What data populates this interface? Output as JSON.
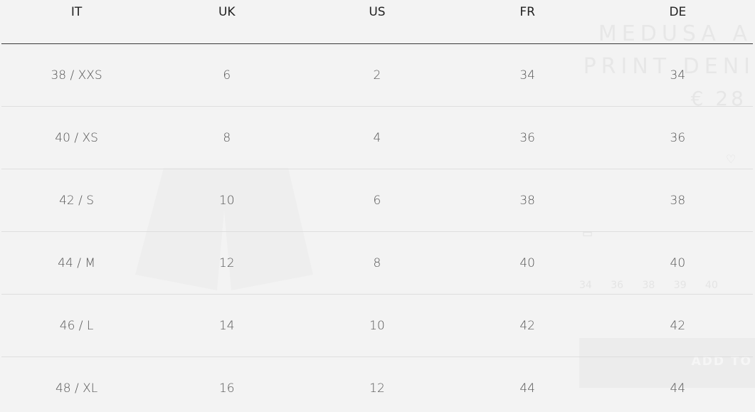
{
  "background": {
    "title_line1": "MEDUSA A",
    "title_line2": "PRINT DENI",
    "price": "€ 28",
    "sizes_row": "34  36  38  39  40",
    "add_button_label": "ADD TO"
  },
  "size_table": {
    "headers": [
      "IT",
      "UK",
      "US",
      "FR",
      "DE"
    ],
    "rows": [
      [
        "38 / XXS",
        "6",
        "2",
        "34",
        "34"
      ],
      [
        "40 / XS",
        "8",
        "4",
        "36",
        "36"
      ],
      [
        "42 / S",
        "10",
        "6",
        "38",
        "38"
      ],
      [
        "44 / M",
        "12",
        "8",
        "40",
        "40"
      ],
      [
        "46 / L",
        "14",
        "10",
        "42",
        "42"
      ],
      [
        "48 / XL",
        "16",
        "12",
        "44",
        "44"
      ]
    ]
  },
  "colors": {
    "background": "#f3f3f3",
    "header_text": "#222222",
    "cell_text": "#555555",
    "header_rule": "#3a3a3a",
    "row_rule": "#dedede"
  }
}
